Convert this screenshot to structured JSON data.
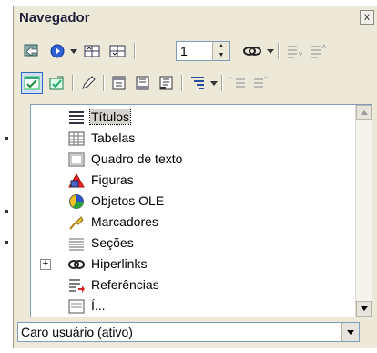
{
  "window": {
    "title": "Navegador",
    "close_label": "x"
  },
  "toolbar1": {
    "spin_value": "1",
    "buttons": [
      {
        "name": "navigation-toggle-icon"
      },
      {
        "name": "navigation-circle-icon"
      },
      {
        "name": "previous-page-icon"
      },
      {
        "name": "next-page-icon"
      },
      {
        "name": "hyperlink-drag-mode-icon"
      },
      {
        "name": "demote-level-icon"
      },
      {
        "name": "promote-level-icon"
      }
    ]
  },
  "toolbar2": {
    "buttons": [
      {
        "name": "content-view-icon"
      },
      {
        "name": "set-reminder-icon"
      },
      {
        "name": "edit-pencil-icon"
      },
      {
        "name": "header-icon"
      },
      {
        "name": "footer-icon"
      },
      {
        "name": "anchor-text-icon"
      },
      {
        "name": "heading-levels-icon"
      },
      {
        "name": "demote-chapter-icon"
      },
      {
        "name": "promote-chapter-icon"
      }
    ]
  },
  "list": {
    "items": [
      {
        "label": "Títulos",
        "icon": "headings-icon",
        "selected": true
      },
      {
        "label": "Tabelas",
        "icon": "table-icon"
      },
      {
        "label": "Quadro de texto",
        "icon": "text-frame-icon"
      },
      {
        "label": "Figuras",
        "icon": "graphics-shapes-icon"
      },
      {
        "label": "Objetos OLE",
        "icon": "ole-object-icon"
      },
      {
        "label": "Marcadores",
        "icon": "bookmark-icon"
      },
      {
        "label": "Seções",
        "icon": "sections-icon"
      },
      {
        "label": "Hiperlinks",
        "icon": "hyperlink-chain-icon",
        "expander": "+"
      },
      {
        "label": "Referências",
        "icon": "references-icon"
      },
      {
        "label": "Í...",
        "icon": "indexes-icon"
      }
    ]
  },
  "document_select": {
    "value": "Caro usuário (ativo)"
  },
  "colors": {
    "window_bg": "#ece9d8",
    "list_border": "#7f9db9",
    "selection_bg": "#d6d3ce"
  }
}
